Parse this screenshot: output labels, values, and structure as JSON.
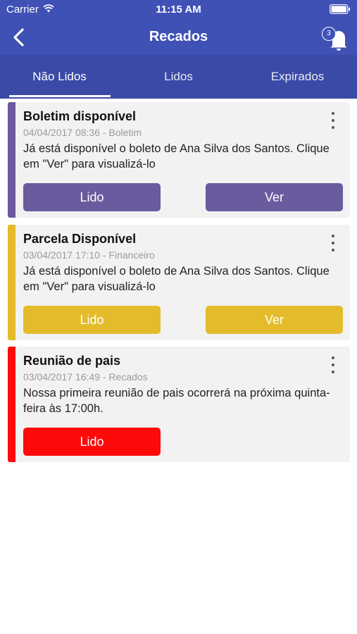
{
  "status_bar": {
    "carrier": "Carrier",
    "time": "11:15 AM"
  },
  "navbar": {
    "title": "Recados",
    "notification_count": "3"
  },
  "tabs": [
    {
      "label": "Não Lidos",
      "active": true
    },
    {
      "label": "Lidos",
      "active": false
    },
    {
      "label": "Expirados",
      "active": false
    }
  ],
  "cards": [
    {
      "title": "Boletim disponível",
      "meta": "04/04/2017 08:36 - Boletim",
      "body": "Já está disponível o boleto de Ana Silva dos Santos. Clique em \"Ver\" para visualizá-lo",
      "accent_color": "#6a5a9e",
      "read_label": "Lido",
      "view_label": "Ver"
    },
    {
      "title": "Parcela Disponível",
      "meta": "03/04/2017 17:10 - Financeiro",
      "body": "Já está disponível o boleto de Ana Silva dos Santos. Clique em \"Ver\" para visualizá-lo",
      "accent_color": "#e4bc2b",
      "read_label": "Lido",
      "view_label": "Ver"
    },
    {
      "title": "Reunião de pais",
      "meta": "03/04/2017 16:49 - Recados",
      "body": "Nossa primeira reunião de pais ocorrerá na próxima quinta-feira às 17:00h.",
      "accent_color": "#ff0a0a",
      "read_label": "Lido"
    }
  ],
  "colors": {
    "header": "#3f51b5",
    "tabs": "#3b4aa6",
    "card_bg": "#f2f2f2"
  }
}
